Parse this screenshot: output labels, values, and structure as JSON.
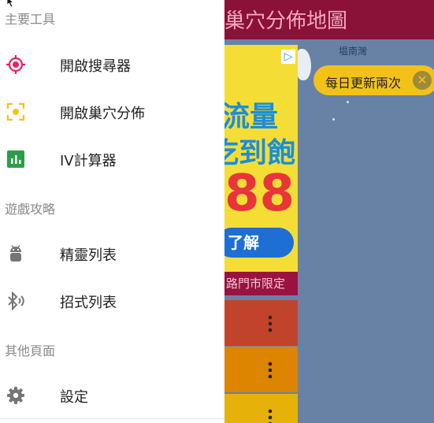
{
  "background_app": {
    "title": "巢穴分佈地圖",
    "map_label": "塭南灣",
    "notice": "每日更新兩次",
    "notice_close": "✕",
    "ad": {
      "badge": "▷",
      "line1": "爆流量",
      "line2": "吃到飽",
      "line3": "88",
      "button": "了解",
      "footer": "路門市限定"
    },
    "row_menu_glyph": "⋮"
  },
  "drawer": {
    "sections": [
      {
        "header": "主要工具",
        "items": [
          {
            "label": "開啟搜尋器",
            "icon": "crosshair-icon",
            "color": "#e91e63"
          },
          {
            "label": "開啟巢穴分佈",
            "icon": "focus-center-icon",
            "color": "#f9c012"
          },
          {
            "label": "IV計算器",
            "icon": "bar-chart-icon",
            "color": "#2e9d4b"
          }
        ]
      },
      {
        "header": "遊戲攻略",
        "items": [
          {
            "label": "精靈列表",
            "icon": "android-icon",
            "color": "#757575"
          },
          {
            "label": "招式列表",
            "icon": "bluetooth-audio-icon",
            "color": "#757575"
          }
        ]
      },
      {
        "header": "其他頁面",
        "items": [
          {
            "label": "設定",
            "icon": "gear-icon",
            "color": "#757575"
          }
        ]
      }
    ]
  },
  "colors": {
    "app_bar": "#8a1138",
    "map": "#6882a6",
    "notice": "#f2c21a"
  }
}
